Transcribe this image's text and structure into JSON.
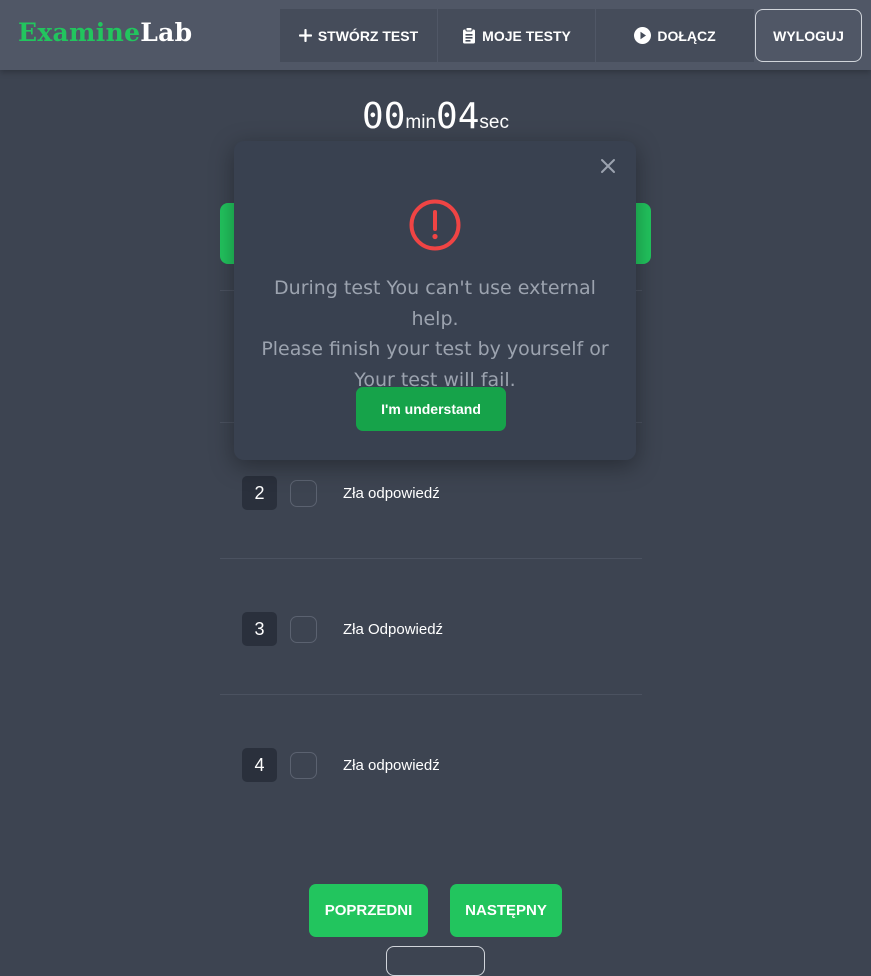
{
  "brand": {
    "part1": "Examine",
    "part2": "Lab"
  },
  "nav": {
    "create_test": "STWÓRZ TEST",
    "my_tests": "MOJE TESTY",
    "join": "DOŁĄCZ",
    "logout": "WYLOGUJ"
  },
  "timer": {
    "minutes": "00",
    "min_unit": "min",
    "seconds": "04",
    "sec_unit": "sec"
  },
  "answers": [
    {
      "number": "2",
      "label": "Zła odpowiedź"
    },
    {
      "number": "3",
      "label": "Zła Odpowiedź"
    },
    {
      "number": "4",
      "label": "Zła odpowiedź"
    }
  ],
  "pagination": {
    "prev": "POPRZEDNI",
    "next": "NASTĘPNY"
  },
  "modal": {
    "line1": "During test You can't use external help.",
    "line2": "Please finish your test by yourself or",
    "line3": "Your test will fail.",
    "button": "I'm understand"
  },
  "colors": {
    "accent_green": "#22c55e",
    "alert_red": "#ef4444",
    "background": "#3d4451"
  },
  "icons": {
    "create": "plus-icon",
    "my_tests": "clipboard-icon",
    "join": "play-circle-icon",
    "close": "close-icon",
    "alert": "exclamation-circle-icon"
  }
}
